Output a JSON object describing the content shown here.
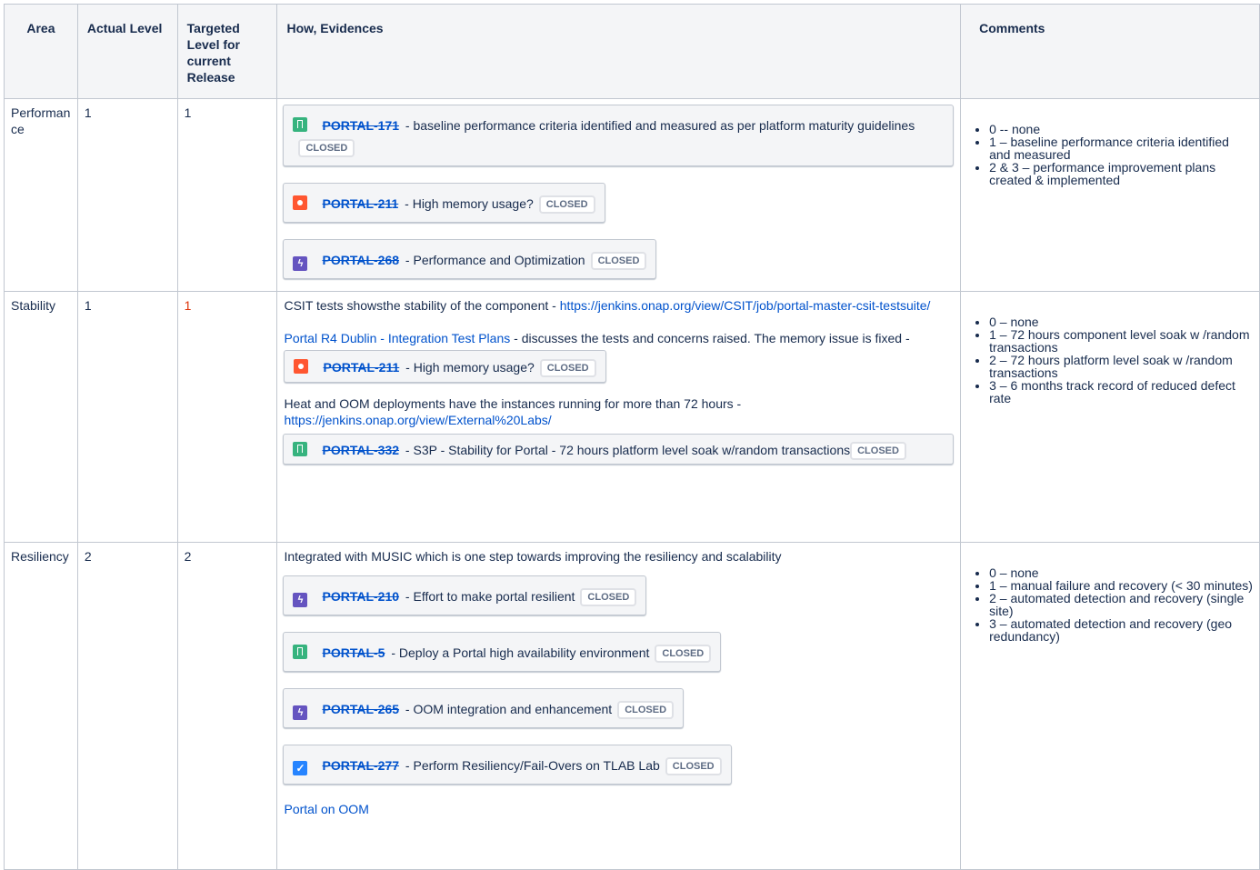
{
  "headers": {
    "area": "Area",
    "actual": "Actual Level",
    "targeted": "Targeted Level for current Release",
    "how": "How, Evidences",
    "comments": "Comments"
  },
  "rows": [
    {
      "area": "Performance",
      "actual": "1",
      "targeted": "1",
      "issues": [
        {
          "icon": "story-icon",
          "key": "PORTAL-171",
          "summary": "baseline performance criteria identified and measured as per platform maturity guidelines",
          "status": "CLOSED"
        },
        {
          "icon": "bug-icon",
          "key": "PORTAL-211",
          "summary": "High memory usage?",
          "status": "CLOSED"
        },
        {
          "icon": "epic-icon",
          "key": "PORTAL-268",
          "summary": "Performance and Optimization",
          "status": "CLOSED"
        }
      ],
      "comments": [
        "0 -- none",
        "1 – baseline performance criteria identified and measured",
        "2 & 3 – performance improvement plans created & implemented"
      ]
    },
    {
      "area": "Stability",
      "actual": "1",
      "targeted": "1",
      "text1": "CSIT tests showsthe stability of the component - ",
      "link1": "https://jenkins.onap.org/view/CSIT/job/portal-master-csit-testsuite/",
      "link2": "Portal R4 Dublin - Integration Test Plans",
      "text2": " - discusses the tests and concerns raised. The memory issue is fixed - ",
      "inline_issue": {
        "icon": "bug-icon",
        "key": "PORTAL-211",
        "summary": "High memory usage?",
        "status": "CLOSED"
      },
      "text3": "Heat and OOM deployments have the instances running for more than 72 hours - ",
      "link3": "https://jenkins.onap.org/view/External%20Labs/",
      "issues": [
        {
          "icon": "story-icon",
          "key": "PORTAL-332",
          "summary": "S3P - Stability for Portal - 72 hours platform level soak w/random transactions",
          "status": "CLOSED"
        }
      ],
      "comments": [
        "0 – none",
        "1 – 72 hours component level soak w /random transactions",
        "2 – 72 hours platform level soak w /random transactions",
        "3 – 6 months track record of reduced defect rate"
      ]
    },
    {
      "area": "Resiliency",
      "actual": "2",
      "targeted": "2",
      "text1": "Integrated with MUSIC which is one step towards improving the resiliency and scalability",
      "issues": [
        {
          "icon": "epic-icon",
          "key": "PORTAL-210",
          "summary": "Effort to make portal resilient",
          "status": "CLOSED"
        },
        {
          "icon": "story-icon",
          "key": "PORTAL-5",
          "summary": "Deploy a Portal high availability environment",
          "status": "CLOSED"
        },
        {
          "icon": "epic-icon",
          "key": "PORTAL-265",
          "summary": "OOM integration and enhancement",
          "status": "CLOSED"
        },
        {
          "icon": "task-icon",
          "key": "PORTAL-277",
          "summary": "Perform Resiliency/Fail-Overs on TLAB Lab",
          "status": "CLOSED"
        }
      ],
      "link1": "Portal on OOM",
      "comments": [
        "0 – none",
        "1 – manual failure and recovery (< 30 minutes)",
        "2 – automated detection and recovery (single site)",
        "3 – automated detection and recovery (geo redundancy)"
      ]
    }
  ]
}
